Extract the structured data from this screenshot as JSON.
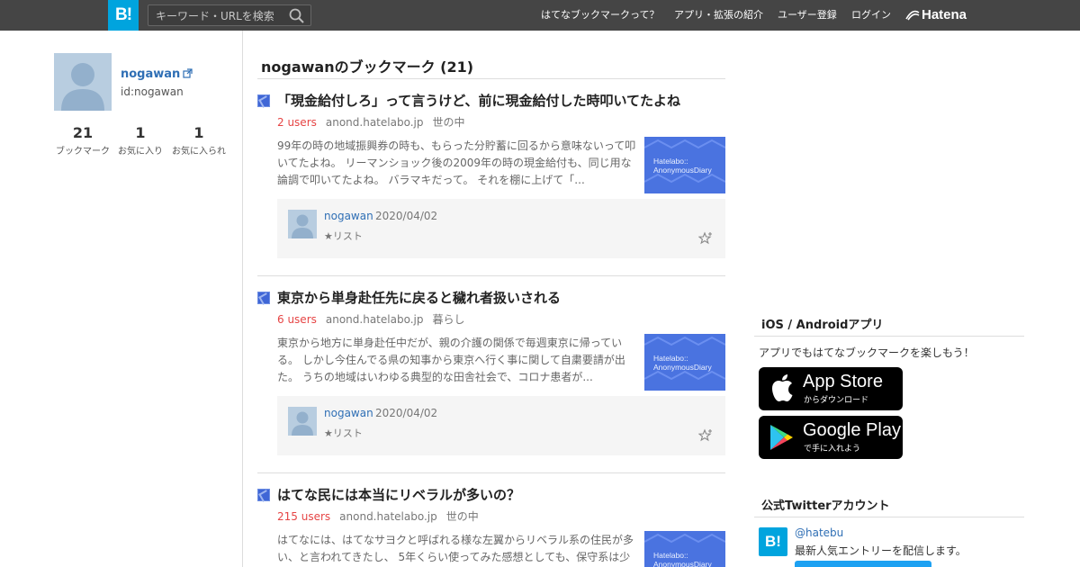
{
  "header": {
    "logo_text": "B!",
    "search_placeholder": "キーワード・URLを検索",
    "nav": [
      "はてなブックマークって？",
      "アプリ・拡張の紹介",
      "ユーザー登録",
      "ログイン"
    ],
    "brand": "Hatena"
  },
  "profile": {
    "name": "nogawan",
    "id": "id:nogawan",
    "stats": [
      {
        "value": "21",
        "label": "ブックマーク"
      },
      {
        "value": "1",
        "label": "お気に入り"
      },
      {
        "value": "1",
        "label": "お気に入られ"
      }
    ]
  },
  "main": {
    "title": "nogawanのブックマーク (21)",
    "entries": [
      {
        "title": "「現金給付しろ」って言うけど、前に現金給付した時叩いてたよね",
        "users": "2 users",
        "domain": "anond.hatelabo.jp",
        "category": "世の中",
        "summary": "99年の時の地域振興券の時も、もらった分貯蓄に回るから意味ないって叩いてたよね。 リーマンショック後の2009年の時の現金給付も、同じ用な論調で叩いてたよね。 バラマキだって。 それを棚に上げて「...",
        "thumb_text": [
          "Hatelabo::",
          "AnonymousDiary"
        ],
        "comment": {
          "user": "nogawan",
          "date": "2020/04/02",
          "list": "★リスト"
        }
      },
      {
        "title": "東京から単身赴任先に戻ると穢れ者扱いされる",
        "users": "6 users",
        "domain": "anond.hatelabo.jp",
        "category": "暮らし",
        "summary": "東京から地方に単身赴任中だが、親の介護の関係で毎週東京に帰っている。 しかし今住んでる県の知事から東京へ行く事に関して自粛要請が出た。 うちの地域はいわゆる典型的な田舎社会で、コロナ患者が...",
        "thumb_text": [
          "Hatelabo::",
          "AnonymousDiary"
        ],
        "comment": {
          "user": "nogawan",
          "date": "2020/04/02",
          "list": "★リスト"
        }
      },
      {
        "title": "はてな民には本当にリベラルが多いの？",
        "users": "215 users",
        "domain": "anond.hatelabo.jp",
        "category": "世の中",
        "summary": "はてなには、はてなサヨクと呼ばれる様な左翼からリベラル系の住民が多い、と言われてきたし、 5年くらい使ってみた感想としても、保守系は少",
        "thumb_text": [
          "Hatelabo::",
          "AnonymousDiary"
        ]
      }
    ]
  },
  "sidebar": {
    "apps_title": "iOS / Androidアプリ",
    "apps_text": "アプリでもはてなブックマークを楽しもう！",
    "appstore": {
      "big": "App Store",
      "small": "からダウンロード"
    },
    "googleplay": {
      "big": "Google Play",
      "small": "で手に入れよう"
    },
    "twitter_title": "公式Twitterアカウント",
    "twitter_logo": "B!",
    "twitter_handle": "@hatebu",
    "twitter_desc": "最新人気エントリーを配信します。"
  },
  "colors": {
    "header_bg": "#454545",
    "brand_blue": "#00a4de",
    "users_red": "#e64545",
    "link_blue": "#2f6fb5"
  }
}
